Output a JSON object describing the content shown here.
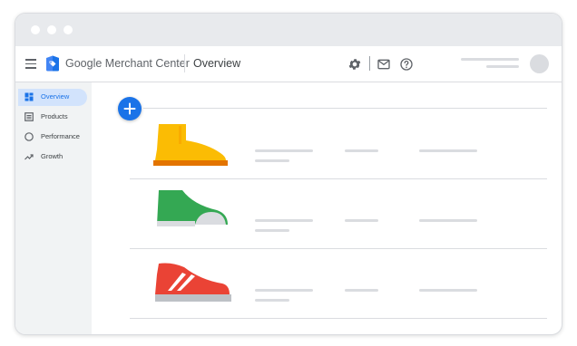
{
  "window": {
    "controls": [
      "close",
      "minimize",
      "maximize"
    ]
  },
  "appbar": {
    "menu_icon": "hamburger-icon",
    "logo_icon": "merchant-center-logo",
    "brand": "Google Merchant Center",
    "page_title": "Overview",
    "actions": [
      {
        "name": "settings",
        "icon": "gear-icon"
      },
      {
        "name": "notifications",
        "icon": "mail-icon"
      },
      {
        "name": "help",
        "icon": "help-icon"
      }
    ],
    "account_avatar": "avatar"
  },
  "sidebar": {
    "items": [
      {
        "label": "Overview",
        "icon": "overview-icon",
        "active": true
      },
      {
        "label": "Products",
        "icon": "products-icon",
        "active": false
      },
      {
        "label": "Performance",
        "icon": "performance-icon",
        "active": false
      },
      {
        "label": "Growth",
        "icon": "growth-icon",
        "active": false
      }
    ]
  },
  "main": {
    "add_button_icon": "plus-icon",
    "products": [
      {
        "image": "yellow-boot",
        "color": "#fbbc04"
      },
      {
        "image": "green-sneaker",
        "color": "#34a853"
      },
      {
        "image": "red-high-top-sneaker",
        "color": "#ea4335"
      }
    ]
  },
  "colors": {
    "accent": "#1a73e8",
    "sidebar_active_bg": "#d2e3fc",
    "placeholder": "#dadce0",
    "chrome": "#e8eaed"
  }
}
